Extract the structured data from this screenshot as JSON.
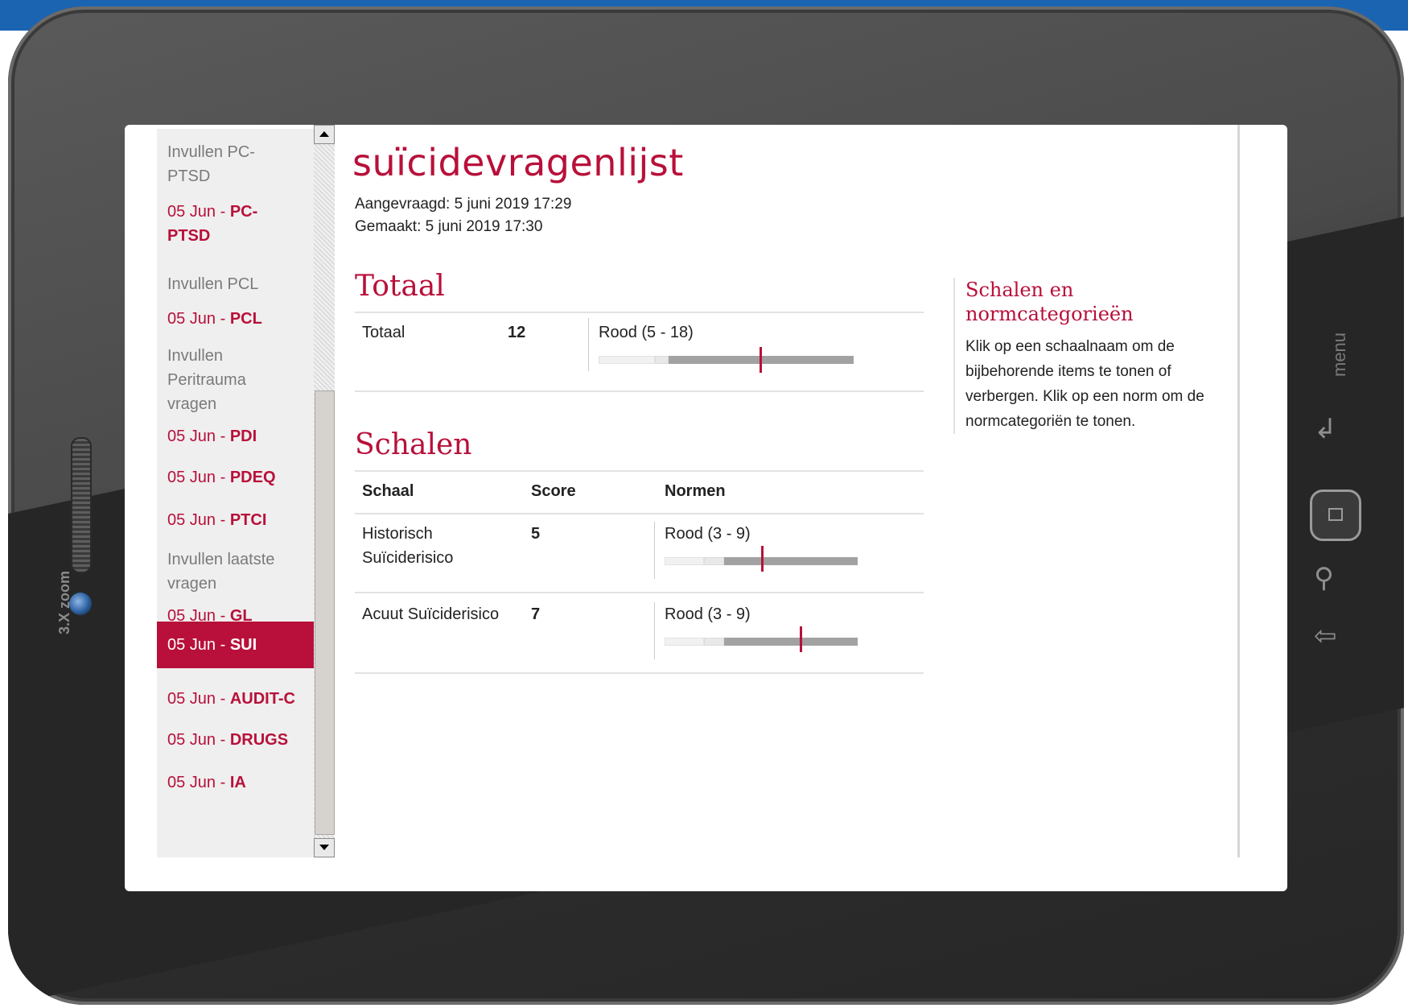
{
  "sidebar": {
    "items": [
      {
        "type": "label",
        "text": "Invullen PC-PTSD"
      },
      {
        "type": "link",
        "date": "05 Jun - ",
        "code": "PC-PTSD"
      },
      {
        "type": "label",
        "text": "Invullen PCL"
      },
      {
        "type": "link",
        "date": "05 Jun - ",
        "code": "PCL"
      },
      {
        "type": "label",
        "text": "Invullen Peritrauma vragen"
      },
      {
        "type": "link",
        "date": "05 Jun - ",
        "code": "PDI"
      },
      {
        "type": "link",
        "date": "05 Jun - ",
        "code": "PDEQ"
      },
      {
        "type": "link",
        "date": "05 Jun - ",
        "code": "PTCI"
      },
      {
        "type": "label",
        "text": "Invullen laatste vragen"
      },
      {
        "type": "link",
        "date": "05 Jun - ",
        "code": "GL"
      },
      {
        "type": "link",
        "date": "05 Jun - ",
        "code": "SUI",
        "active": true
      },
      {
        "type": "link",
        "date": "05 Jun - ",
        "code": "AUDIT-C"
      },
      {
        "type": "link",
        "date": "05 Jun - ",
        "code": "DRUGS"
      },
      {
        "type": "link",
        "date": "05 Jun - ",
        "code": "IA"
      }
    ]
  },
  "main": {
    "title": "suïcidevragenlijst",
    "requested": "Aangevraagd: 5 juni 2019 17:29",
    "made": "Gemaakt: 5 juni 2019 17:30",
    "total_section": {
      "heading": "Totaal",
      "row": {
        "name": "Totaal",
        "score": "12",
        "norm": "Rood (5 - 18)",
        "marker_fraction": 0.63
      }
    },
    "scales_section": {
      "heading": "Schalen",
      "col_scale": "Schaal",
      "col_score": "Score",
      "col_norms": "Normen",
      "rows": [
        {
          "name_line1": "Historisch",
          "name_line2": "Suïciderisico",
          "score": "5",
          "norm": "Rood (3 - 9)",
          "marker_fraction": 0.5
        },
        {
          "name_line1": "Acuut Suïciderisico",
          "name_line2": "",
          "score": "7",
          "norm": "Rood (3 - 9)",
          "marker_fraction": 0.7
        }
      ]
    }
  },
  "aside": {
    "heading": "Schalen en normcategorieën",
    "text": "Klik op een schaalnaam om de bijbehorende items te tonen of verbergen. Klik op een norm om de normcategoriën te tonen."
  },
  "device": {
    "zoom_label": "3.X zoom",
    "menu_label": "menu"
  },
  "colors": {
    "accent": "#b8103a",
    "bar_dark": "#a2a2a2",
    "bar_light": "#f1f1f1"
  }
}
